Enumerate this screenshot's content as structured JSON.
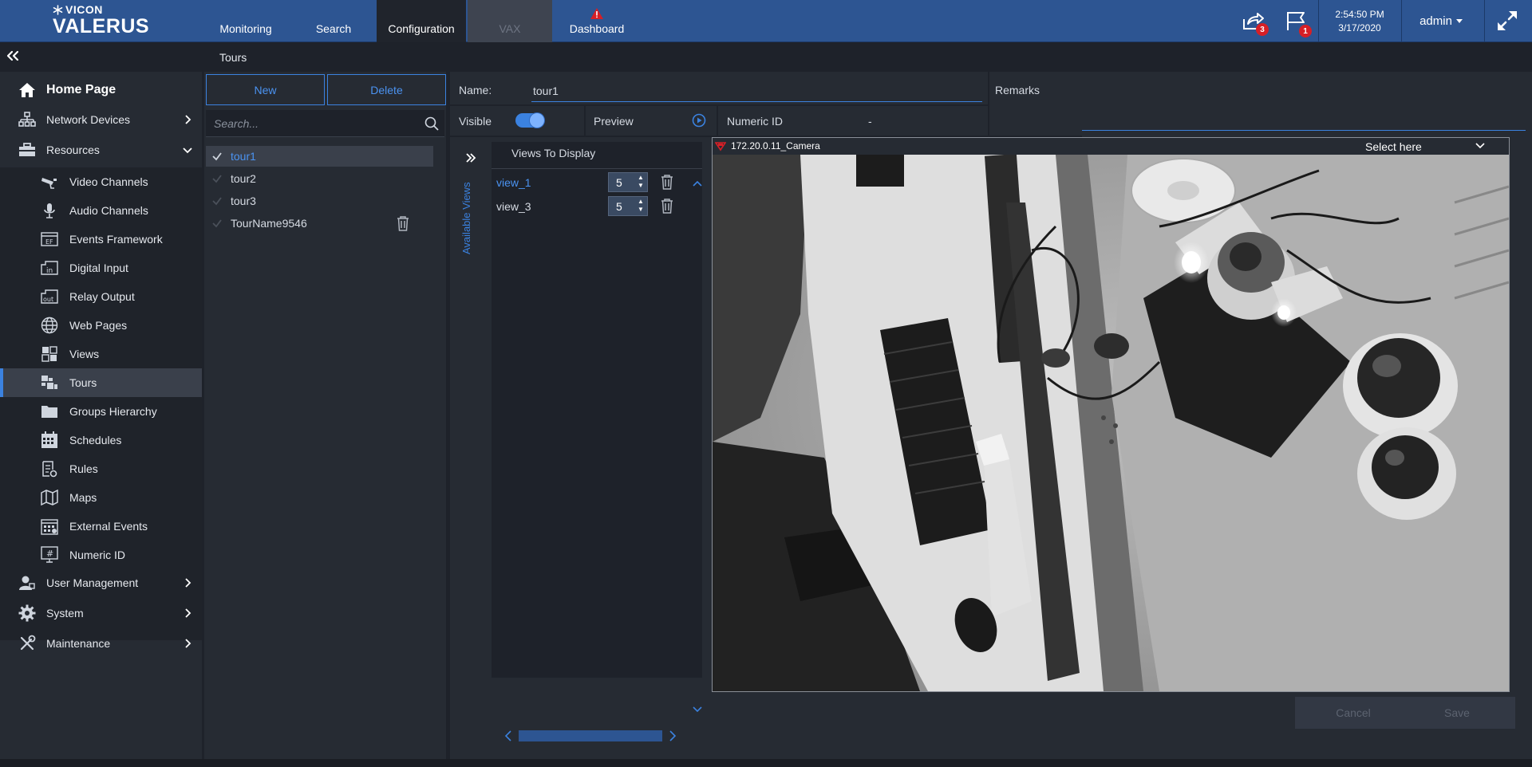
{
  "app": {
    "brand": "VICON",
    "product": "VALERUS"
  },
  "nav": {
    "tabs": [
      {
        "label": "Monitoring"
      },
      {
        "label": "Search"
      },
      {
        "label": "Configuration"
      },
      {
        "label": "VAX"
      },
      {
        "label": "Dashboard"
      }
    ]
  },
  "topbar": {
    "export_badge": "3",
    "alarm_badge": "1",
    "time": "2:54:50 PM",
    "date": "3/17/2020",
    "user": "admin"
  },
  "page": {
    "title": "Tours"
  },
  "sidebar": {
    "items": [
      {
        "label": "Home Page",
        "icon": "home-icon"
      },
      {
        "label": "Network Devices",
        "icon": "network-icon"
      },
      {
        "label": "Resources",
        "icon": "toolbox-icon"
      }
    ],
    "resources": [
      {
        "label": "Video Channels",
        "icon": "camera-icon"
      },
      {
        "label": "Audio Channels",
        "icon": "microphone-icon"
      },
      {
        "label": "Events Framework",
        "icon": "events-framework-icon",
        "tag": "EF"
      },
      {
        "label": "Digital Input",
        "icon": "digital-input-icon",
        "tag": "in"
      },
      {
        "label": "Relay Output",
        "icon": "relay-output-icon",
        "tag": "out"
      },
      {
        "label": "Web Pages",
        "icon": "globe-icon"
      },
      {
        "label": "Views",
        "icon": "views-icon"
      },
      {
        "label": "Tours",
        "icon": "tours-icon"
      },
      {
        "label": "Groups Hierarchy",
        "icon": "folder-icon"
      },
      {
        "label": "Schedules",
        "icon": "calendar-icon"
      },
      {
        "label": "Rules",
        "icon": "rules-icon"
      },
      {
        "label": "Maps",
        "icon": "map-icon"
      },
      {
        "label": "External Events",
        "icon": "external-events-icon"
      },
      {
        "label": "Numeric ID",
        "icon": "numeric-id-icon"
      }
    ],
    "bottom": [
      {
        "label": "User Management",
        "icon": "user-icon"
      },
      {
        "label": "System",
        "icon": "gear-icon"
      },
      {
        "label": "Maintenance",
        "icon": "tools-icon"
      }
    ]
  },
  "list": {
    "new_label": "New",
    "delete_label": "Delete",
    "search_placeholder": "Search...",
    "tours": [
      {
        "label": "tour1"
      },
      {
        "label": "tour2"
      },
      {
        "label": "tour3"
      },
      {
        "label": "TourName9546"
      }
    ]
  },
  "editor": {
    "name_label": "Name:",
    "name_value": "tour1",
    "remarks_label": "Remarks",
    "visible_label": "Visible",
    "visible_on": true,
    "preview_label": "Preview",
    "numeric_id_label": "Numeric ID",
    "numeric_id_value": "-",
    "available_views_label": "Available Views",
    "views_to_display_label": "Views To Display",
    "views": [
      {
        "label": "view_1",
        "duration": "5"
      },
      {
        "label": "view_3",
        "duration": "5"
      }
    ],
    "camera_label": "172.20.0.11_Camera",
    "select_label": "Select here",
    "cancel_label": "Cancel",
    "save_label": "Save"
  },
  "colors": {
    "header": "#2d5592",
    "accent": "#3b82e0",
    "badge": "#d61f26",
    "panel": "#262b33",
    "background": "#1e222a"
  }
}
